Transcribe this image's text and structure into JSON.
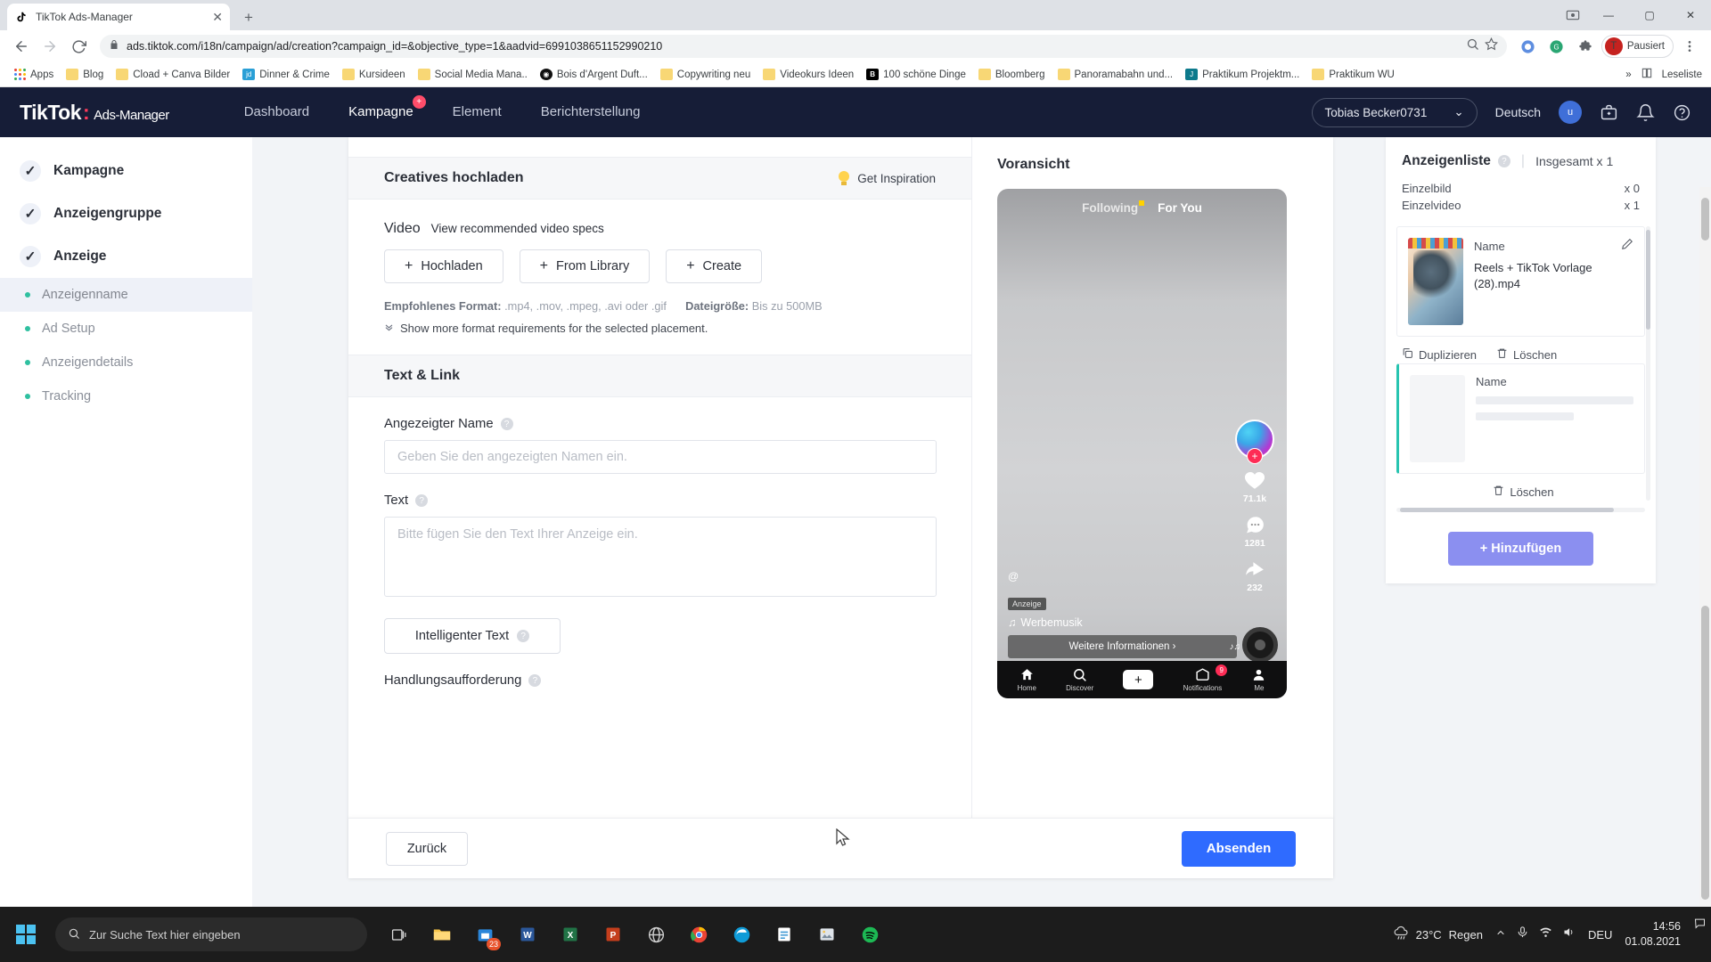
{
  "browser": {
    "tab": {
      "title": "TikTok Ads-Manager",
      "close_label": "✕",
      "favicon": "tiktok-icon"
    },
    "newtab_label": "+",
    "url": "ads.tiktok.com/i18n/campaign/ad/creation?campaign_id=&objective_type=1&aadvid=6991038651152990210",
    "profile": {
      "initial": "T",
      "label": "Pausiert"
    },
    "window_controls": {
      "minimize": "—",
      "maximize": "▢",
      "close": "✕"
    },
    "bookmarks": [
      {
        "label": "Apps",
        "icon": "apps-grid-icon"
      },
      {
        "label": "Blog",
        "icon": "folder-icon"
      },
      {
        "label": "Cload + Canva Bilder",
        "icon": "folder-icon"
      },
      {
        "label": "Dinner & Crime",
        "icon": "jd-icon"
      },
      {
        "label": "Kursideen",
        "icon": "folder-icon"
      },
      {
        "label": "Social Media Mana..",
        "icon": "folder-icon"
      },
      {
        "label": "Bois d'Argent Duft...",
        "icon": "dark-circle-icon"
      },
      {
        "label": "Copywriting neu",
        "icon": "folder-icon"
      },
      {
        "label": "Videokurs Ideen",
        "icon": "folder-icon"
      },
      {
        "label": "100 schöne Dinge",
        "icon": "bloomberg-b-icon"
      },
      {
        "label": "Bloomberg",
        "icon": "folder-icon"
      },
      {
        "label": "Panoramabahn und...",
        "icon": "folder-icon"
      },
      {
        "label": "Praktikum Projektm...",
        "icon": "teal-j-icon"
      },
      {
        "label": "Praktikum WU",
        "icon": "folder-icon"
      }
    ],
    "bookmarks_overflow": "»",
    "reading_list": "Leseliste"
  },
  "topnav": {
    "logo": "TikTok",
    "logo_dot": ":",
    "logo_sub": "Ads-Manager",
    "items": [
      {
        "label": "Dashboard",
        "badge": ""
      },
      {
        "label": "Kampagne",
        "badge": "+"
      },
      {
        "label": "Element",
        "badge": ""
      },
      {
        "label": "Berichterstellung",
        "badge": ""
      }
    ],
    "account": "Tobias Becker0731",
    "account_chevron": "⌄",
    "language": "Deutsch",
    "avatar_initial": "u",
    "icons": [
      "briefcase-icon",
      "bell-icon",
      "help-icon"
    ]
  },
  "sidebar": {
    "steps": [
      {
        "label": "Kampagne",
        "check": "✓"
      },
      {
        "label": "Anzeigengruppe",
        "check": "✓"
      },
      {
        "label": "Anzeige",
        "check": "✓"
      }
    ],
    "subitems": [
      {
        "label": "Anzeigenname",
        "active": true
      },
      {
        "label": "Ad Setup",
        "active": false
      },
      {
        "label": "Anzeigendetails",
        "active": false
      },
      {
        "label": "Tracking",
        "active": false
      }
    ]
  },
  "upload_section": {
    "title": "Creatives hochladen",
    "inspiration": "Get Inspiration",
    "video_label": "Video",
    "video_specs_link": "View recommended video specs",
    "buttons": [
      {
        "label": "Hochladen",
        "plus": "+"
      },
      {
        "label": "From Library",
        "plus": "+"
      },
      {
        "label": "Create",
        "plus": "+"
      }
    ],
    "format_label": "Empfohlenes Format:",
    "format_value": ".mp4, .mov, .mpeg, .avi oder .gif",
    "filesize_label": "Dateigröße:",
    "filesize_value": "Bis zu 500MB",
    "more_requirements": "Show more format requirements for the selected placement.",
    "chevron": "⌄"
  },
  "text_link_section": {
    "title": "Text & Link",
    "display_name_label": "Angezeigter Name",
    "display_name_placeholder": "Geben Sie den angezeigten Namen ein.",
    "display_name_value": "",
    "text_label": "Text",
    "text_placeholder": "Bitte fügen Sie den Text Ihrer Anzeige ein.",
    "text_value": "",
    "smart_text_button": "Intelligenter Text",
    "cta_label": "Handlungsaufforderung",
    "help_icon": "?"
  },
  "preview": {
    "title": "Voransicht",
    "tab_following": "Following",
    "tab_foryou": "For You",
    "likes": "71.1k",
    "comments": "1281",
    "shares": "232",
    "handle": "@",
    "ad_tag": "Anzeige",
    "music": "Werbemusik",
    "music_note": "♫",
    "cta_text": "Weitere Informationen ›",
    "bottom_nav": [
      {
        "label": "Home",
        "icon": "home-icon",
        "badge": ""
      },
      {
        "label": "Discover",
        "icon": "search-icon",
        "badge": ""
      },
      {
        "label": "",
        "icon": "plus-icon",
        "badge": ""
      },
      {
        "label": "Notifications",
        "icon": "inbox-icon",
        "badge": "9"
      },
      {
        "label": "Me",
        "icon": "person-icon",
        "badge": ""
      }
    ]
  },
  "adlist": {
    "title": "Anzeigenliste",
    "help_icon": "?",
    "total_label": "Insgesamt x 1",
    "counts": [
      {
        "label": "Einzelbild",
        "value": "x 0"
      },
      {
        "label": "Einzelvideo",
        "value": "x 1"
      }
    ],
    "cards": [
      {
        "name_label": "Name",
        "edit_icon": "pencil-icon",
        "filename": "Reels + TikTok Vorlage (28).mp4",
        "actions": [
          {
            "label": "Duplizieren",
            "icon": "duplicate-icon"
          },
          {
            "label": "Löschen",
            "icon": "trash-icon"
          }
        ]
      },
      {
        "name_label": "Name",
        "edit_icon": "",
        "filename": "",
        "actions": [
          {
            "label": "Löschen",
            "icon": "trash-icon"
          }
        ]
      }
    ],
    "add_button": "+ Hinzufügen"
  },
  "footer": {
    "back": "Zurück",
    "submit": "Absenden"
  },
  "taskbar": {
    "search_placeholder": "Zur Suche Text hier eingeben",
    "apps": [
      {
        "name": "task-view-icon",
        "badge": ""
      },
      {
        "name": "file-explorer-icon",
        "badge": ""
      },
      {
        "name": "store-icon",
        "badge": "23"
      },
      {
        "name": "word-icon",
        "badge": ""
      },
      {
        "name": "excel-icon",
        "badge": ""
      },
      {
        "name": "powerpoint-icon",
        "badge": ""
      },
      {
        "name": "browser-icon",
        "badge": ""
      },
      {
        "name": "chrome-icon",
        "badge": ""
      },
      {
        "name": "edge-icon",
        "badge": ""
      },
      {
        "name": "sheets-icon",
        "badge": ""
      },
      {
        "name": "photos-icon",
        "badge": ""
      },
      {
        "name": "spotify-icon",
        "badge": ""
      }
    ],
    "weather_temp": "23°C",
    "weather_desc": "Regen",
    "time": "14:56",
    "date": "01.08.2021",
    "lang": "DEU"
  }
}
